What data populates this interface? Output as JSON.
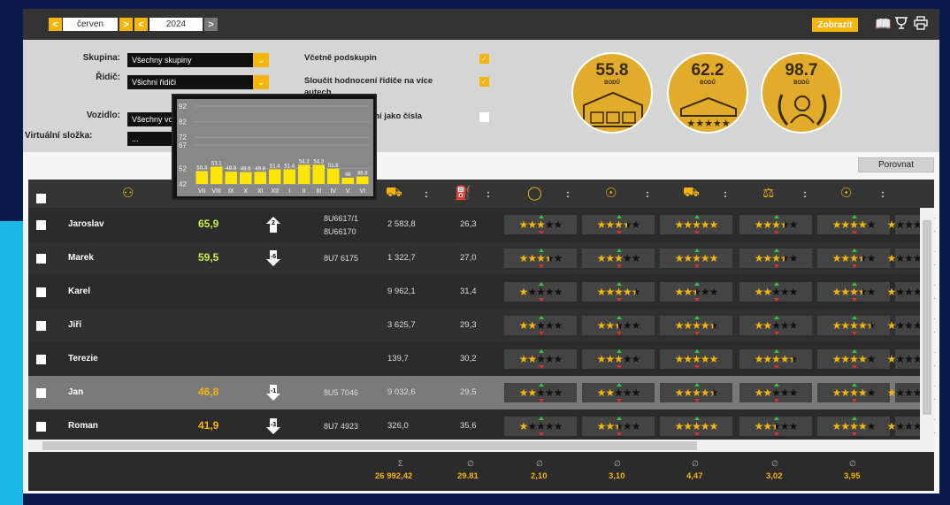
{
  "topbar": {
    "month": "červen",
    "year": "2024",
    "prev": "<",
    "next": ">",
    "zobrazit": "Zobrazit"
  },
  "filters": {
    "skupina_label": "Skupina:",
    "skupina_value": "Všechny skupiny",
    "ridic_label": "Řidič:",
    "ridic_value": "Všichni řidiči",
    "vozidlo_label": "Vozidlo:",
    "vozidlo_value": "Všechny vozidla",
    "virtualni_label": "Virtuální složka:",
    "virtualni_value": "...",
    "opt1": "Včetně podskupin",
    "opt2a": "Sloučit hodnocení řidiče na více",
    "opt2b": "autech",
    "opt3": "Zobrazit hodnocení jako čísla"
  },
  "badges": [
    {
      "value": "55.8",
      "label": "BODŮ"
    },
    {
      "value": "62.2",
      "label": "BODŮ"
    },
    {
      "value": "98.7",
      "label": "BODŮ"
    }
  ],
  "porovnat": "Porovnat",
  "rows": [
    {
      "name": "Jaroslav",
      "score": "65,9",
      "score_color": "#c7f04a",
      "trend": "2",
      "trend_dir": "up",
      "plate1": "8U6617/1",
      "plate2": "8U66170",
      "km": "2 583,8",
      "cons": "26,3",
      "stars": [
        3,
        3.5,
        5,
        3.5,
        4,
        1
      ]
    },
    {
      "name": "Marek",
      "score": "59,5",
      "score_color": "#c7f04a",
      "trend": "-6",
      "trend_dir": "down",
      "plate1": "8U7 6175",
      "plate2": "",
      "km": "1 322,7",
      "cons": "27,0",
      "stars": [
        3.5,
        3,
        5,
        3.5,
        3.5,
        1
      ]
    },
    {
      "name": "Karel",
      "score": "",
      "score_color": "#c7f04a",
      "trend": "",
      "trend_dir": "",
      "plate1": "",
      "plate2": "",
      "km": "9 962,1",
      "cons": "31,4",
      "stars": [
        1,
        4.5,
        2.5,
        2,
        3.5,
        1
      ]
    },
    {
      "name": "Jiří",
      "score": "",
      "score_color": "#c7f04a",
      "trend": "",
      "trend_dir": "",
      "plate1": "",
      "plate2": "",
      "km": "3 625,7",
      "cons": "29,3",
      "stars": [
        2,
        2.5,
        4.5,
        2,
        4.5,
        1
      ]
    },
    {
      "name": "Terezie",
      "score": "",
      "score_color": "#c7f04a",
      "trend": "",
      "trend_dir": "",
      "plate1": "",
      "plate2": "",
      "km": "139,7",
      "cons": "30,2",
      "stars": [
        2,
        3,
        5,
        4.5,
        4,
        1
      ]
    },
    {
      "name": "Jan",
      "score": "46,8",
      "score_color": "#f5b50a",
      "trend": "-1",
      "trend_dir": "down",
      "plate1": "8U5 7046",
      "plate2": "",
      "km": "9 032,6",
      "cons": "29,5",
      "stars": [
        2,
        2,
        4.5,
        2,
        4,
        1
      ]
    },
    {
      "name": "Roman",
      "score": "41,9",
      "score_color": "#f5b50a",
      "trend": "-3",
      "trend_dir": "down",
      "plate1": "8U7 4923",
      "plate2": "",
      "km": "326,0",
      "cons": "35,6",
      "stars": [
        1,
        2.5,
        5,
        2.5,
        4,
        1
      ]
    }
  ],
  "footer": {
    "km_sym": "Σ",
    "km_val": "26 992,42",
    "cons_sym": "∅",
    "cons_val": "29.81",
    "c1_sym": "∅",
    "c1_val": "2,10",
    "c2_sym": "∅",
    "c2_val": "3,10",
    "c3_sym": "∅",
    "c3_val": "4,47",
    "c4_sym": "∅",
    "c4_val": "3,02",
    "c5_sym": "∅",
    "c5_val": "3,95"
  },
  "chart_data": {
    "type": "bar",
    "categories": [
      "VII",
      "VIII",
      "IX",
      "X",
      "XI",
      "XII",
      "I",
      "II",
      "III",
      "IV",
      "V",
      "VI"
    ],
    "values": [
      50.3,
      53.1,
      49.9,
      49.6,
      49.8,
      51.4,
      51.4,
      54.3,
      54.3,
      51.8,
      46,
      46.8
    ],
    "value_labels": [
      "50.3",
      "53.1",
      "49.9",
      "49.6",
      "49.8",
      "51.4",
      "51.4",
      "54.3",
      "54.3",
      "51.8",
      "46",
      "46.8"
    ],
    "yticks": [
      "92",
      "82",
      "72",
      "67",
      "52",
      "42"
    ],
    "ylim": [
      42,
      92
    ],
    "bar_color": "#ffe600",
    "grid": true
  }
}
